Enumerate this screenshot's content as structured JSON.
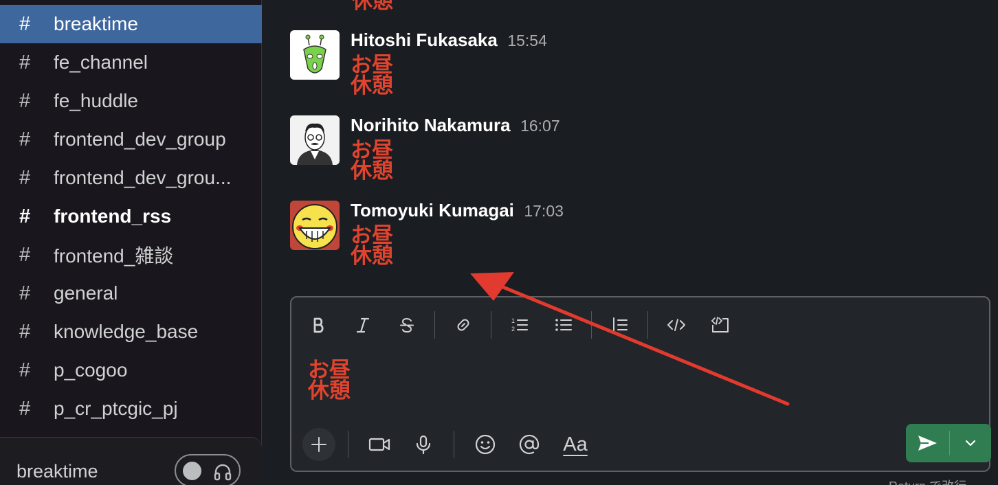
{
  "sidebar": {
    "channels": [
      {
        "label": "breaktime"
      },
      {
        "label": "fe_channel"
      },
      {
        "label": "fe_huddle"
      },
      {
        "label": "frontend_dev_group"
      },
      {
        "label": "frontend_dev_grou..."
      },
      {
        "label": "frontend_rss"
      },
      {
        "label": "frontend_雑談"
      },
      {
        "label": "general"
      },
      {
        "label": "knowledge_base"
      },
      {
        "label": "p_cogoo"
      },
      {
        "label": "p_cr_ptcgic_pj"
      }
    ],
    "hash_symbol": "#",
    "active_channel": "breaktime",
    "bold_channel": "frontend_rss",
    "huddle": {
      "label": "breaktime"
    }
  },
  "messages": {
    "partial_top_text": "休憩",
    "items": [
      {
        "author": "Hitoshi Fukasaka",
        "time": "15:54",
        "line1": "お昼",
        "line2": "休憩",
        "avatar_icon": "green-alien-avatar"
      },
      {
        "author": "Norihito Nakamura",
        "time": "16:07",
        "line1": "お昼",
        "line2": "休憩",
        "avatar_icon": "man-with-glasses-avatar"
      },
      {
        "author": "Tomoyuki Kumagai",
        "time": "17:03",
        "line1": "お昼",
        "line2": "休憩",
        "avatar_icon": "grinning-face-avatar"
      }
    ]
  },
  "composer": {
    "line1": "お昼",
    "line2": "休憩",
    "format_label": "Aa",
    "hint_text": "Return で改行"
  },
  "colors": {
    "sidebar_bg": "#19171d",
    "active_channel_bg": "#3e679d",
    "emoji_text": "#e0432e",
    "send_button": "#2f7d51",
    "annotation_arrow": "#e23a2e"
  }
}
